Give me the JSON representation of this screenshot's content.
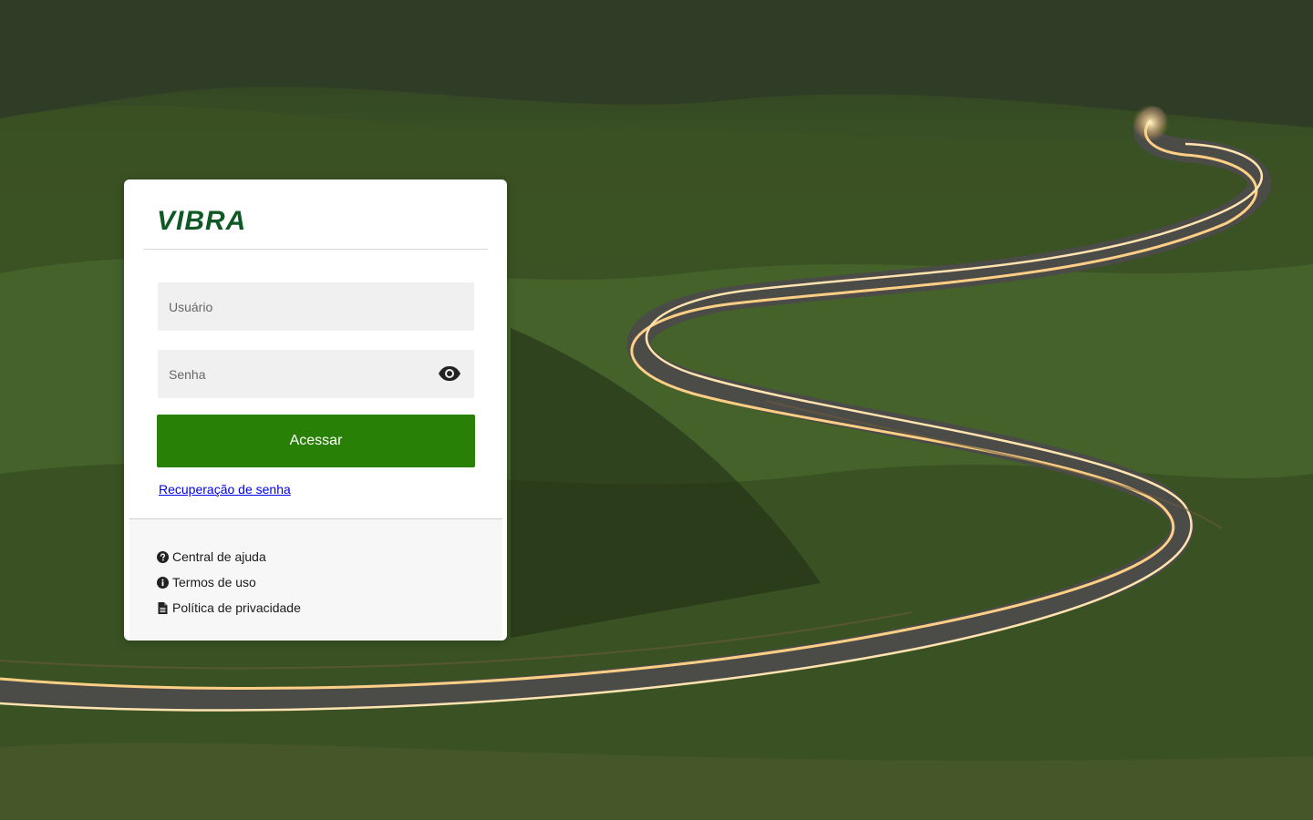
{
  "background": {
    "description_icon": "winding-road-landscape",
    "accent_light": "#ffd79a"
  },
  "brand": {
    "logo_text": "VIBRA",
    "color": "#0f5a24"
  },
  "login": {
    "username_placeholder": "Usuário",
    "password_placeholder": "Senha",
    "toggle_icon": "eye-icon",
    "submit_label": "Acessar",
    "submit_color": "#288007",
    "recover_label": "Recuperação de senha"
  },
  "footer": {
    "links": [
      {
        "label": "Central de ajuda",
        "icon": "question-circle-icon"
      },
      {
        "label": "Termos de uso",
        "icon": "info-circle-icon"
      },
      {
        "label": "Política de privacidade",
        "icon": "document-icon"
      }
    ]
  }
}
